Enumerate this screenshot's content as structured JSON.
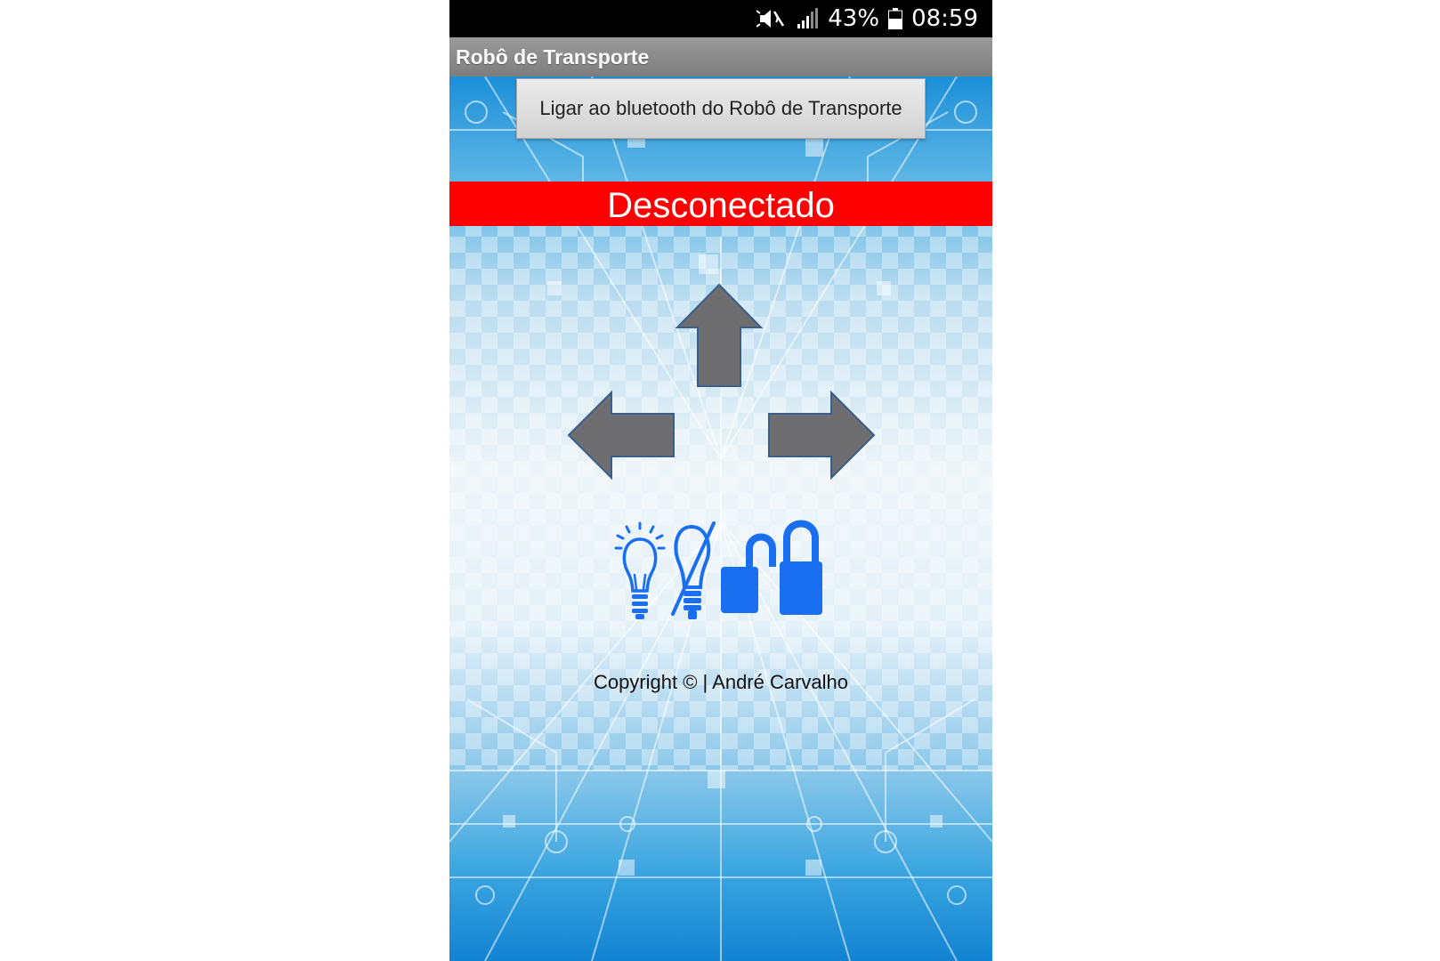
{
  "status_bar": {
    "battery_percent": "43%",
    "time": "08:59",
    "icons": [
      "mute-icon",
      "signal-icon",
      "battery-icon"
    ]
  },
  "app": {
    "title": "Robô de Transporte"
  },
  "connect_button": {
    "label": "Ligar ao bluetooth do Robô de Transporte"
  },
  "connection_status": {
    "text": "Desconectado",
    "color": "#ff0000"
  },
  "controls": {
    "arrows": [
      "arrow-up-icon",
      "arrow-left-icon",
      "arrow-right-icon"
    ],
    "arrow_color": "#6e6d70",
    "action_icons": [
      "light-on-icon",
      "light-off-icon",
      "unlock-icon",
      "lock-icon"
    ],
    "action_color": "#1a6ef0"
  },
  "footer": {
    "copyright": "Copyright © | André Carvalho"
  }
}
